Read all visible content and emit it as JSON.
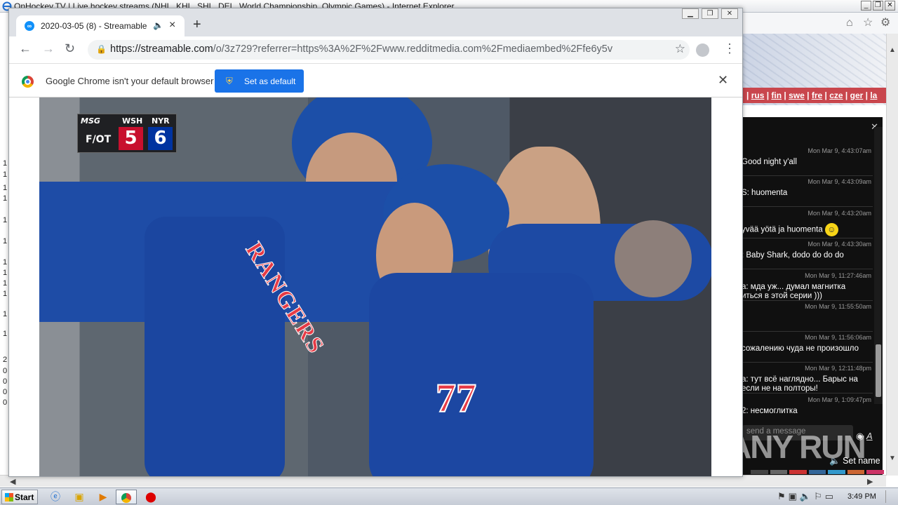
{
  "ie": {
    "title": "OnHockey.TV | Live hockey streams (NHL, KHL, SHL, DEL, World Championship, Olympic Games) - Internet Explorer",
    "languages": [
      "rus",
      "fin",
      "swe",
      "fre",
      "cze",
      "ger",
      "la"
    ]
  },
  "chat": {
    "messages": [
      {
        "time": "Mon Mar 9, 4:43:07am",
        "text": "Good night y'all"
      },
      {
        "time": "Mon Mar 9, 4:43:09am",
        "text": "S: huomenta"
      },
      {
        "time": "Mon Mar 9, 4:43:20am",
        "text": "yvää yötä ja huomenta"
      },
      {
        "time": "Mon Mar 9, 4:43:30am",
        "text": ": Baby Shark, dodo do do do"
      },
      {
        "time": "Mon Mar 9, 11:27:46am",
        "text": "а: мда уж... думал магнитка",
        "text2": "иться в этой серии )))"
      },
      {
        "time": "Mon Mar 9, 11:55:50am",
        "text": ""
      },
      {
        "time": "Mon Mar 9, 11:56:06am",
        "text": "сожалению чуда не произошло"
      },
      {
        "time": "Mon Mar 9, 12:11:48pm",
        "text": "а: тут всё наглядно... Барыс на",
        "text2": "если не на полторы!"
      },
      {
        "time": "Mon Mar 9, 1:09:47pm",
        "text": "2: несмоглитка"
      }
    ],
    "input_placeholder": "send a message",
    "set_name": "Set name"
  },
  "chrome": {
    "tab_title": "2020-03-05 (8) - Streamable",
    "url_host": "https://streamable.com",
    "url_path": "/o/3z729?referrer=https%3A%2F%2Fwww.redditmedia.com%2Fmediaembed%2Ffe6y5v",
    "infobar_text": "Google Chrome isn't your default browser",
    "set_default_label": "Set as default"
  },
  "video": {
    "network": "MSG",
    "away_team": "WSH",
    "home_team": "NYR",
    "period": "F/OT",
    "away_score": "5",
    "home_score": "6",
    "jersey_text": "RANGERS",
    "jersey_number": "77"
  },
  "taskbar": {
    "start_label": "Start",
    "clock": "3:49 PM"
  },
  "left_strip": [
    "1",
    "1",
    "1",
    "1",
    "1",
    "1",
    "1",
    "1",
    "1",
    "1",
    "1",
    "1",
    "2",
    "0",
    "0",
    "0",
    "0"
  ],
  "watermark": "ANY RUN",
  "colors": {
    "chrome_blue": "#1a73e8",
    "score_red": "#c8102e",
    "score_blue": "#0033a0",
    "chat_bg": "#101010",
    "lang_bar": "#c9464d"
  }
}
